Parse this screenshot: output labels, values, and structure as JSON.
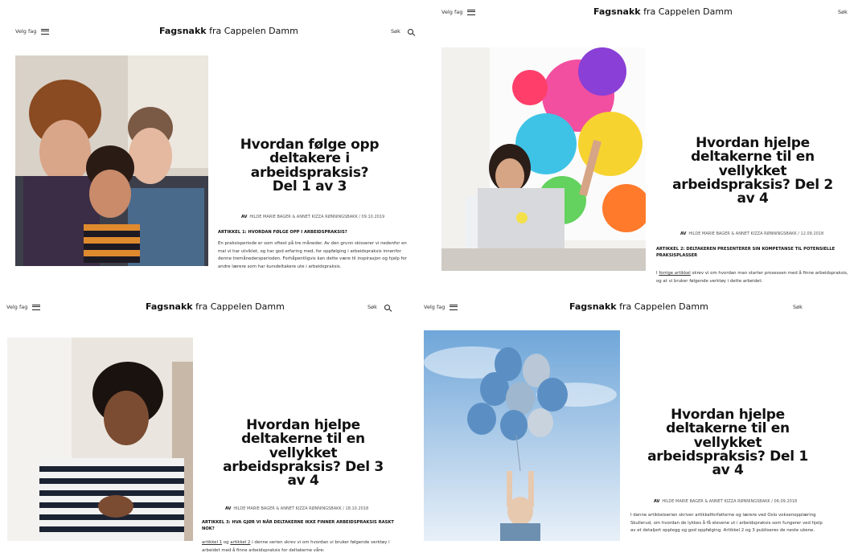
{
  "site": {
    "menu_label": "Velg fag",
    "brand_bold": "Fagsnakk",
    "brand_rest": " fra Cappelen Damm",
    "search_label": "Søk"
  },
  "articles": [
    {
      "title": "Hvordan følge opp deltakere i arbeidspraksis? Del 1 av 3",
      "by": "AV",
      "authors": "HILDE MARIE BAGER & ANNET KIZZA RØNNINGSBAKK / 09.10.2019",
      "label": "ARTIKKEL 1: HVORDAN FØLGE OPP I ARBEIDSPRAKSIS?",
      "excerpt": "En praksisperiode er som oftest på tre måneder. Av den grunn skisserer vi nedenfor en mal vi har utviklet, og har god erfaring med, for oppfølging i arbeidspraksis innenfor denne tremånedersperioden. Forhåpentligvis kan dette være til inspirasjon og hjelp for andre lærere som har kursdeltakere ute i arbeidspraksis.",
      "image": "selfie-group-photo"
    },
    {
      "title": "Hvordan hjelpe deltakerne til en vellykket arbeidspraksis? Del 2 av 4",
      "by": "AV",
      "authors": "HILDE MARIE BAGER & ANNET KIZZA RØNNINGSBAKK / 12.09.2018",
      "label": "ARTIKKEL 2: DELTAKEREN PRESENTERER SIN KOMPETANSE TIL POTENSIELLE PRAKSISPLASSER",
      "excerpt_link": "forrige artikkel",
      "excerpt_pre": "I ",
      "excerpt_post": " skrev vi om hvordan man starter prosessen med å finne arbeidspraksis, og at vi bruker følgende verktøy i dette arbeidet:",
      "image": "woman-laptop-paint-splash-photo"
    },
    {
      "title": "Hvordan hjelpe deltakerne til en vellykket arbeidspraksis? Del 3 av 4",
      "by": "AV",
      "authors": "HILDE MARIE BAGER & ANNET KIZZA RØNNINGSBAKK / 18.10.2018",
      "label": "ARTIKKEL 3: HVA GJØR VI NÅR DELTAKERNE IKKE FINNER ARBEIDSPRAKSIS RASKT NOK?",
      "link1": "artikkel 1",
      "mid": " og ",
      "link2": "artikkel 2",
      "excerpt_post": " i denne serien skrev vi om hvordan vi bruker følgende verktøy i arbeidet med å finne arbeidspraksis for deltakerne våre:",
      "image": "woman-striped-shirt-photo"
    },
    {
      "title": "Hvordan hjelpe deltakerne til en vellykket arbeidspraksis? Del 1 av 4",
      "by": "AV",
      "authors": "HILDE MARIE BAGER & ANNET KIZZA RØNNINGSBAKK / 06.09.2018",
      "excerpt": "I denne artikkelserien skriver artikkelforfatterne og lærere ved Oslo voksenopplæring Skullerud, om hvordan de lykkes å få elevene ut i arbeidspraksis som fungerer ved hjelp av et detaljert opplegg og god oppfølging. Artikkel 2 og 3 publiseres de neste ukene.",
      "image": "girl-blue-balloons-photo"
    }
  ],
  "colors": {
    "balloon": "#5b8fc4",
    "sky": "#cfe0f3"
  }
}
